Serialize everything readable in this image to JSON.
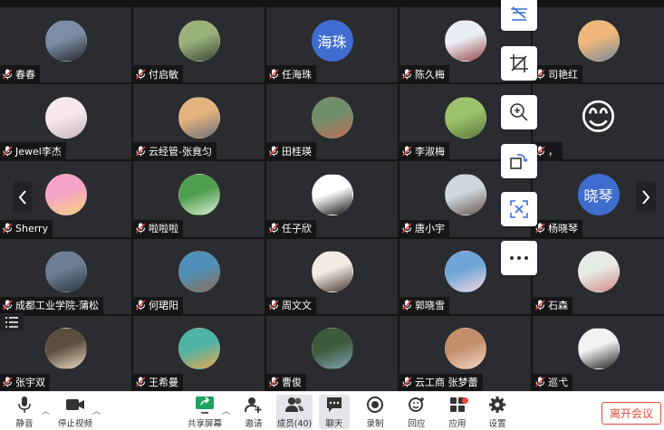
{
  "participants": [
    {
      "name": "春春",
      "avatar_text": "",
      "avatar_colors": [
        "#7c8ea6",
        "#2b2a32"
      ]
    },
    {
      "name": "付启敏",
      "avatar_text": "",
      "avatar_colors": [
        "#9ab27a",
        "#3c4a36"
      ]
    },
    {
      "name": "任海珠",
      "avatar_text": "海珠",
      "avatar_colors": [
        "#3f6dcf",
        "#3f6dcf"
      ]
    },
    {
      "name": "陈久梅",
      "avatar_text": "",
      "avatar_colors": [
        "#e9eef5",
        "#9c4b4b"
      ]
    },
    {
      "name": "司艳红",
      "avatar_text": "",
      "avatar_colors": [
        "#f0b77a",
        "#7a8a9a"
      ]
    },
    {
      "name": "Jewel李杰",
      "avatar_text": "",
      "avatar_colors": [
        "#f6e8ee",
        "#c9b6c0"
      ]
    },
    {
      "name": "云经管-张竟匀",
      "avatar_text": "",
      "avatar_colors": [
        "#e3b27e",
        "#6f6f7a"
      ]
    },
    {
      "name": "田桂瑛",
      "avatar_text": "",
      "avatar_colors": [
        "#6f8f6a",
        "#c0705a"
      ]
    },
    {
      "name": "李淑梅",
      "avatar_text": "",
      "avatar_colors": [
        "#9cc36b",
        "#5c7a3c"
      ]
    },
    {
      "name": "，",
      "avatar_text": "😊",
      "avatar_colors": [
        "#f7c531",
        "#f0a020"
      ]
    },
    {
      "name": "Sherry",
      "avatar_text": "",
      "avatar_colors": [
        "#f7a3c8",
        "#f3d27a"
      ]
    },
    {
      "name": "啦啦啦",
      "avatar_text": "",
      "avatar_colors": [
        "#4f9e4f",
        "#d9ecd0"
      ]
    },
    {
      "name": "任子欣",
      "avatar_text": "",
      "avatar_colors": [
        "#ffffff",
        "#111111"
      ]
    },
    {
      "name": "唐小宇",
      "avatar_text": "",
      "avatar_colors": [
        "#cfd7dc",
        "#6b5a52"
      ]
    },
    {
      "name": "杨晓琴",
      "avatar_text": "晓琴",
      "avatar_colors": [
        "#3f6dcf",
        "#3f6dcf"
      ]
    },
    {
      "name": "成都工业学院-蒲松",
      "avatar_text": "",
      "avatar_colors": [
        "#6d7f94",
        "#2e3540"
      ]
    },
    {
      "name": "何珺阳",
      "avatar_text": "",
      "avatar_colors": [
        "#4f8fb8",
        "#8a6d5a"
      ]
    },
    {
      "name": "周文文",
      "avatar_text": "",
      "avatar_colors": [
        "#f3ece3",
        "#4a3a33"
      ]
    },
    {
      "name": "郭晓雪",
      "avatar_text": "",
      "avatar_colors": [
        "#6fa6d6",
        "#f3d8e6"
      ]
    },
    {
      "name": "石森",
      "avatar_text": "",
      "avatar_colors": [
        "#e8ece6",
        "#d28a8a"
      ]
    },
    {
      "name": "张宇双",
      "avatar_text": "",
      "avatar_colors": [
        "#5a4e3e",
        "#e8d7bf"
      ]
    },
    {
      "name": "王希曼",
      "avatar_text": "",
      "avatar_colors": [
        "#4fb3a7",
        "#e5a94e"
      ]
    },
    {
      "name": "曹俊",
      "avatar_text": "",
      "avatar_colors": [
        "#3d5a3a",
        "#7fa0b0"
      ]
    },
    {
      "name": "云工商 张梦蕾",
      "avatar_text": "",
      "avatar_colors": [
        "#c48d6c",
        "#f1d7c4"
      ]
    },
    {
      "name": "巡弋",
      "avatar_text": "",
      "avatar_colors": [
        "#f2f2f2",
        "#222222"
      ]
    }
  ],
  "side_tools": [
    "annotate-icon",
    "crop-icon",
    "zoom-icon",
    "rotate-icon",
    "text-recognition-icon",
    "more-icon"
  ],
  "toolbar": {
    "mute": "静音",
    "stop_video": "停止视频",
    "share_screen": "共享屏幕",
    "invite": "邀请",
    "members": "成员(40)",
    "chat": "聊天",
    "record": "录制",
    "reaction": "回应",
    "apps": "应用",
    "settings": "设置",
    "leave": "离开会议"
  },
  "colors": {
    "gallery_bg": "#141414",
    "tile_bg": "#2a2c30",
    "leave_red": "#e24b3c",
    "share_green": "#1ca261",
    "avatar_blue": "#3f6dcf",
    "mic_red": "#e0403a"
  }
}
